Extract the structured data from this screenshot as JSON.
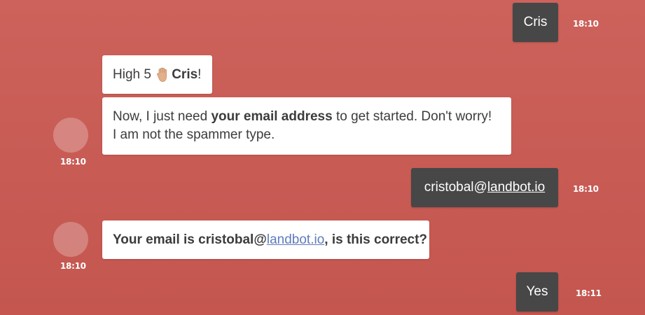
{
  "messages": {
    "user_name": {
      "text": "Cris",
      "time": "18:10"
    },
    "bot_high5": {
      "prefix": "High 5 ",
      "icon": "raised-hand-icon",
      "name": "Cris",
      "suffix": "!"
    },
    "bot_email_request": {
      "part1": "Now, I just need ",
      "bold": "your email address",
      "part2": " to get started. Don't worry!",
      "line2": "I am not the spammer type.",
      "time": "18:10"
    },
    "user_email": {
      "local": "cristobal@",
      "domain": "landbot.io",
      "time": "18:10"
    },
    "bot_confirm": {
      "part1": "Your email is cristobal@",
      "domain": "landbot.io",
      "part2": ", is this correct?",
      "time": "18:10"
    },
    "user_yes": {
      "text": "Yes",
      "time": "18:11"
    }
  },
  "colors": {
    "background": "#c95d56",
    "user_bubble": "#474747",
    "bot_bubble": "#ffffff",
    "link": "#5f7bbd"
  }
}
